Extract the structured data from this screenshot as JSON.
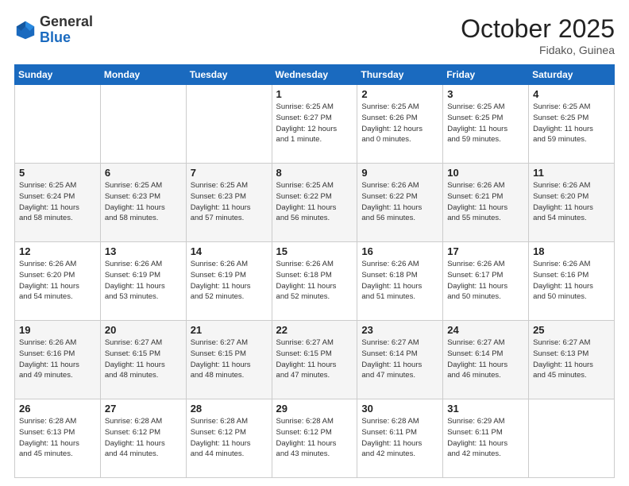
{
  "header": {
    "logo_general": "General",
    "logo_blue": "Blue",
    "month": "October 2025",
    "location": "Fidako, Guinea"
  },
  "days_of_week": [
    "Sunday",
    "Monday",
    "Tuesday",
    "Wednesday",
    "Thursday",
    "Friday",
    "Saturday"
  ],
  "weeks": [
    [
      {
        "day": "",
        "info": ""
      },
      {
        "day": "",
        "info": ""
      },
      {
        "day": "",
        "info": ""
      },
      {
        "day": "1",
        "info": "Sunrise: 6:25 AM\nSunset: 6:27 PM\nDaylight: 12 hours\nand 1 minute."
      },
      {
        "day": "2",
        "info": "Sunrise: 6:25 AM\nSunset: 6:26 PM\nDaylight: 12 hours\nand 0 minutes."
      },
      {
        "day": "3",
        "info": "Sunrise: 6:25 AM\nSunset: 6:25 PM\nDaylight: 11 hours\nand 59 minutes."
      },
      {
        "day": "4",
        "info": "Sunrise: 6:25 AM\nSunset: 6:25 PM\nDaylight: 11 hours\nand 59 minutes."
      }
    ],
    [
      {
        "day": "5",
        "info": "Sunrise: 6:25 AM\nSunset: 6:24 PM\nDaylight: 11 hours\nand 58 minutes."
      },
      {
        "day": "6",
        "info": "Sunrise: 6:25 AM\nSunset: 6:23 PM\nDaylight: 11 hours\nand 58 minutes."
      },
      {
        "day": "7",
        "info": "Sunrise: 6:25 AM\nSunset: 6:23 PM\nDaylight: 11 hours\nand 57 minutes."
      },
      {
        "day": "8",
        "info": "Sunrise: 6:25 AM\nSunset: 6:22 PM\nDaylight: 11 hours\nand 56 minutes."
      },
      {
        "day": "9",
        "info": "Sunrise: 6:26 AM\nSunset: 6:22 PM\nDaylight: 11 hours\nand 56 minutes."
      },
      {
        "day": "10",
        "info": "Sunrise: 6:26 AM\nSunset: 6:21 PM\nDaylight: 11 hours\nand 55 minutes."
      },
      {
        "day": "11",
        "info": "Sunrise: 6:26 AM\nSunset: 6:20 PM\nDaylight: 11 hours\nand 54 minutes."
      }
    ],
    [
      {
        "day": "12",
        "info": "Sunrise: 6:26 AM\nSunset: 6:20 PM\nDaylight: 11 hours\nand 54 minutes."
      },
      {
        "day": "13",
        "info": "Sunrise: 6:26 AM\nSunset: 6:19 PM\nDaylight: 11 hours\nand 53 minutes."
      },
      {
        "day": "14",
        "info": "Sunrise: 6:26 AM\nSunset: 6:19 PM\nDaylight: 11 hours\nand 52 minutes."
      },
      {
        "day": "15",
        "info": "Sunrise: 6:26 AM\nSunset: 6:18 PM\nDaylight: 11 hours\nand 52 minutes."
      },
      {
        "day": "16",
        "info": "Sunrise: 6:26 AM\nSunset: 6:18 PM\nDaylight: 11 hours\nand 51 minutes."
      },
      {
        "day": "17",
        "info": "Sunrise: 6:26 AM\nSunset: 6:17 PM\nDaylight: 11 hours\nand 50 minutes."
      },
      {
        "day": "18",
        "info": "Sunrise: 6:26 AM\nSunset: 6:16 PM\nDaylight: 11 hours\nand 50 minutes."
      }
    ],
    [
      {
        "day": "19",
        "info": "Sunrise: 6:26 AM\nSunset: 6:16 PM\nDaylight: 11 hours\nand 49 minutes."
      },
      {
        "day": "20",
        "info": "Sunrise: 6:27 AM\nSunset: 6:15 PM\nDaylight: 11 hours\nand 48 minutes."
      },
      {
        "day": "21",
        "info": "Sunrise: 6:27 AM\nSunset: 6:15 PM\nDaylight: 11 hours\nand 48 minutes."
      },
      {
        "day": "22",
        "info": "Sunrise: 6:27 AM\nSunset: 6:15 PM\nDaylight: 11 hours\nand 47 minutes."
      },
      {
        "day": "23",
        "info": "Sunrise: 6:27 AM\nSunset: 6:14 PM\nDaylight: 11 hours\nand 47 minutes."
      },
      {
        "day": "24",
        "info": "Sunrise: 6:27 AM\nSunset: 6:14 PM\nDaylight: 11 hours\nand 46 minutes."
      },
      {
        "day": "25",
        "info": "Sunrise: 6:27 AM\nSunset: 6:13 PM\nDaylight: 11 hours\nand 45 minutes."
      }
    ],
    [
      {
        "day": "26",
        "info": "Sunrise: 6:28 AM\nSunset: 6:13 PM\nDaylight: 11 hours\nand 45 minutes."
      },
      {
        "day": "27",
        "info": "Sunrise: 6:28 AM\nSunset: 6:12 PM\nDaylight: 11 hours\nand 44 minutes."
      },
      {
        "day": "28",
        "info": "Sunrise: 6:28 AM\nSunset: 6:12 PM\nDaylight: 11 hours\nand 44 minutes."
      },
      {
        "day": "29",
        "info": "Sunrise: 6:28 AM\nSunset: 6:12 PM\nDaylight: 11 hours\nand 43 minutes."
      },
      {
        "day": "30",
        "info": "Sunrise: 6:28 AM\nSunset: 6:11 PM\nDaylight: 11 hours\nand 42 minutes."
      },
      {
        "day": "31",
        "info": "Sunrise: 6:29 AM\nSunset: 6:11 PM\nDaylight: 11 hours\nand 42 minutes."
      },
      {
        "day": "",
        "info": ""
      }
    ]
  ]
}
